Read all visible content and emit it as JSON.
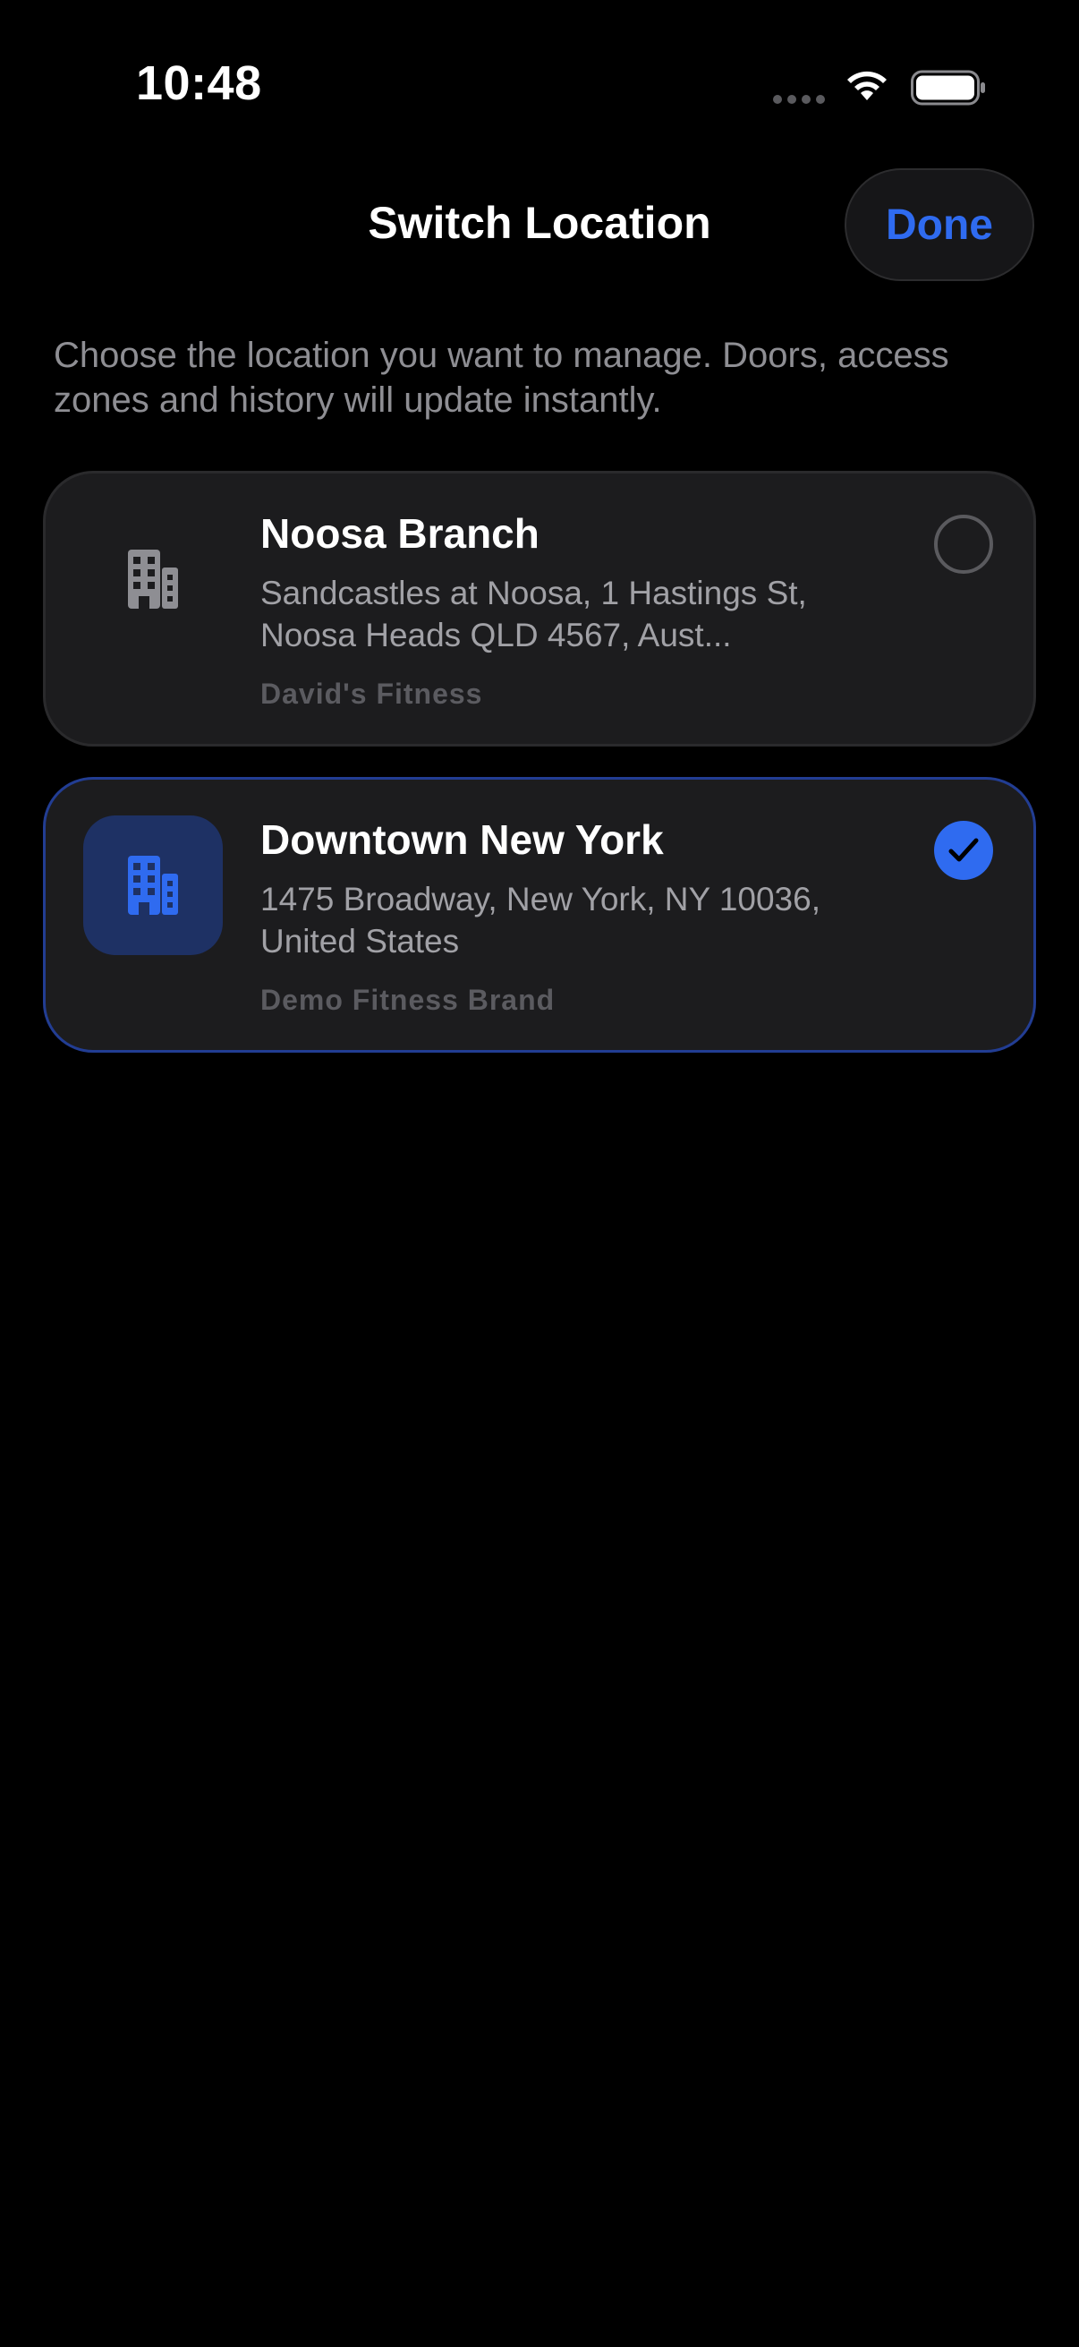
{
  "status_bar": {
    "time": "10:48"
  },
  "header": {
    "title": "Switch Location",
    "done_label": "Done"
  },
  "description": "Choose the location you want to manage. Doors, access zones and history will update instantly.",
  "locations": [
    {
      "name": "Noosa Branch",
      "address": "Sandcastles at Noosa, 1 Hastings St, Noosa Heads QLD 4567, Aust...",
      "brand": "David's Fitness",
      "selected": false,
      "icon": "building-icon"
    },
    {
      "name": "Downtown New York",
      "address": "1475 Broadway, New York, NY 10036, United States",
      "brand": "Demo Fitness Brand",
      "selected": true,
      "icon": "building-icon"
    }
  ],
  "colors": {
    "accent": "#2f6bf0",
    "background": "#000000",
    "card": "#1c1c1e",
    "selected_border": "#223d93",
    "secondary_text": "#8e8e93"
  }
}
